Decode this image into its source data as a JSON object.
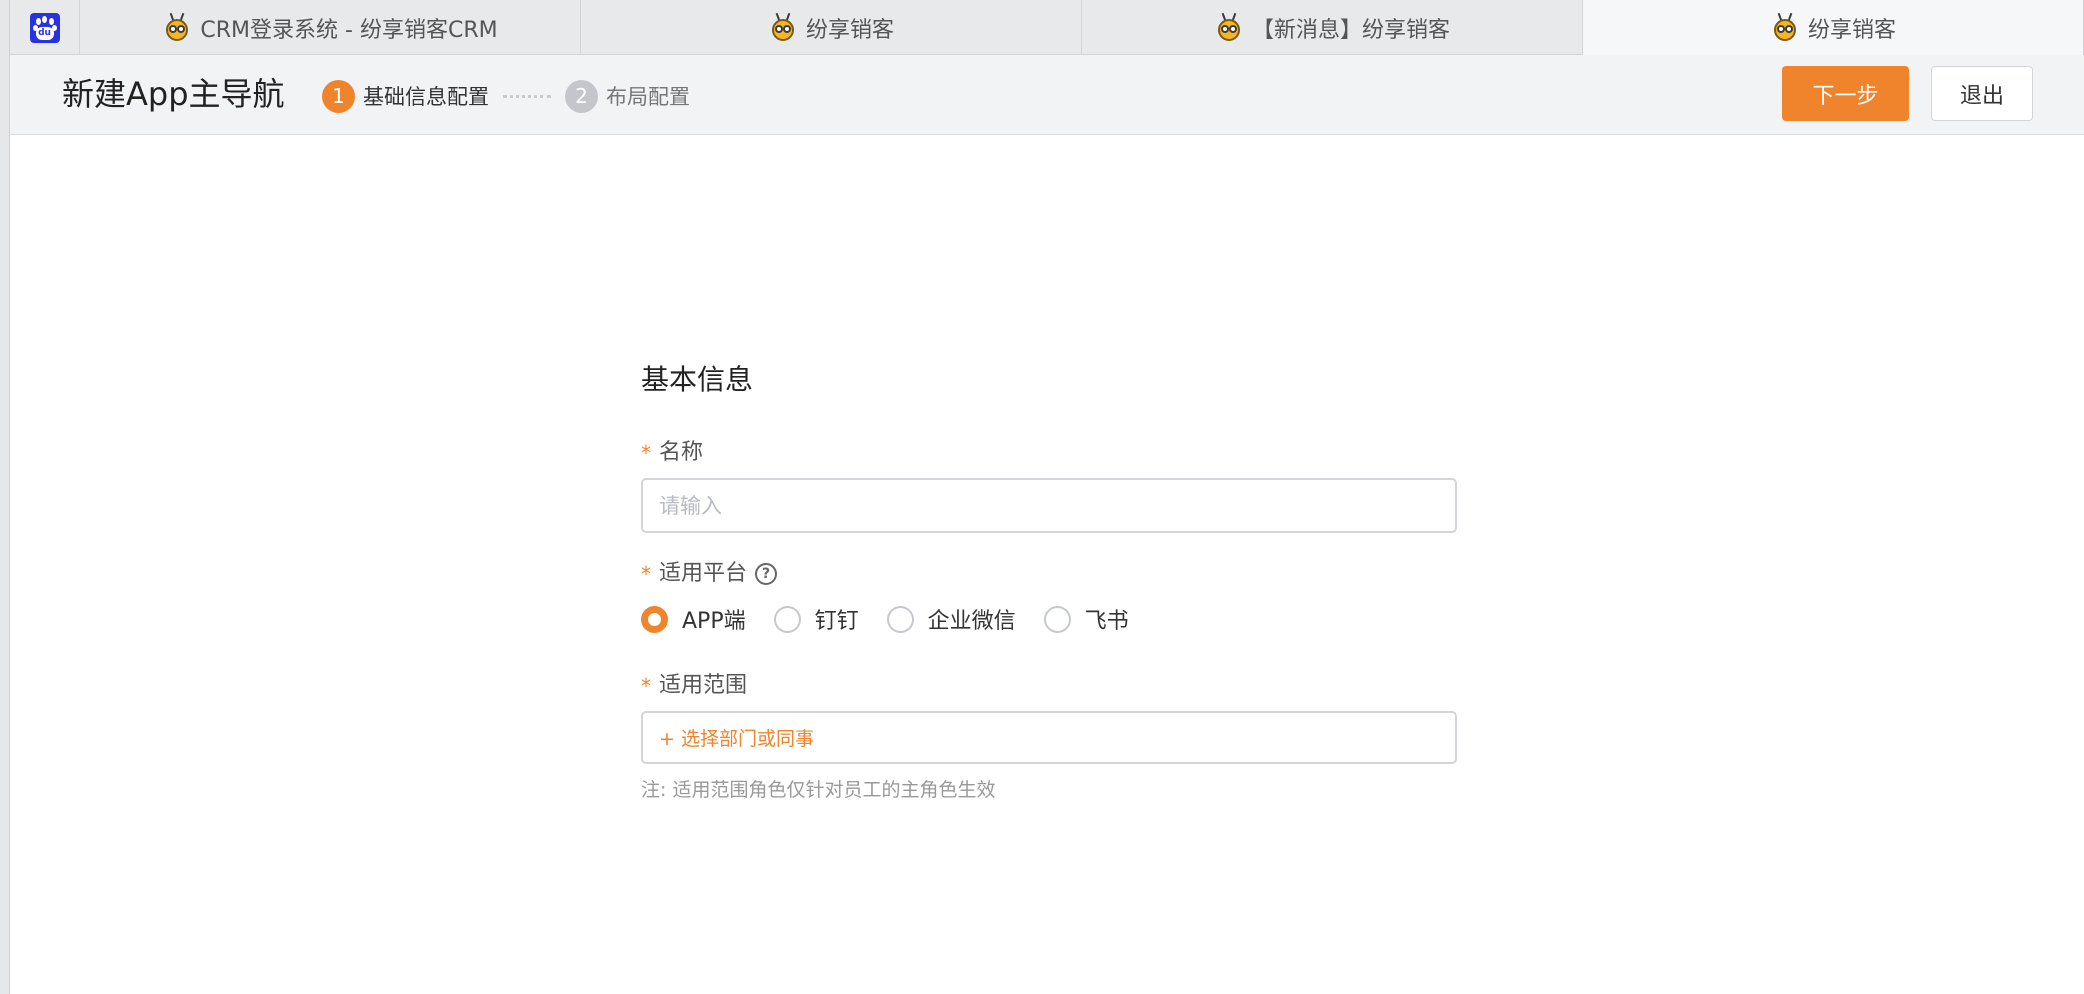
{
  "browser": {
    "site_icon_text": "du",
    "tabs": [
      {
        "title": "CRM登录系统 - 纷享销客CRM",
        "icon": "bee-mascot-icon"
      },
      {
        "title": "纷享销客",
        "icon": "bee-mascot-icon"
      },
      {
        "title": "【新消息】纷享销客",
        "icon": "bee-mascot-icon"
      },
      {
        "title": "纷享销客",
        "icon": "bee-mascot-icon",
        "active": true
      }
    ]
  },
  "header": {
    "title": "新建App主导航",
    "steps": [
      {
        "num": "1",
        "label": "基础信息配置",
        "state": "active"
      },
      {
        "num": "2",
        "label": "布局配置",
        "state": "inactive"
      }
    ],
    "next_label": "下一步",
    "exit_label": "退出"
  },
  "form": {
    "section_title": "基本信息",
    "name_field": {
      "required_mark": "*",
      "label": "名称",
      "placeholder": "请输入",
      "value": ""
    },
    "platform_field": {
      "required_mark": "*",
      "label": "适用平台",
      "help_icon": "?",
      "options": [
        "APP端",
        "钉钉",
        "企业微信",
        "飞书"
      ],
      "selected": "APP端"
    },
    "scope_field": {
      "required_mark": "*",
      "label": "适用范围",
      "picker_text": "+ 选择部门或同事"
    },
    "note": "注: 适用范围角色仅针对员工的主角色生效"
  },
  "colors": {
    "accent": "#f0842c",
    "brand_blue": "#2932e1"
  }
}
